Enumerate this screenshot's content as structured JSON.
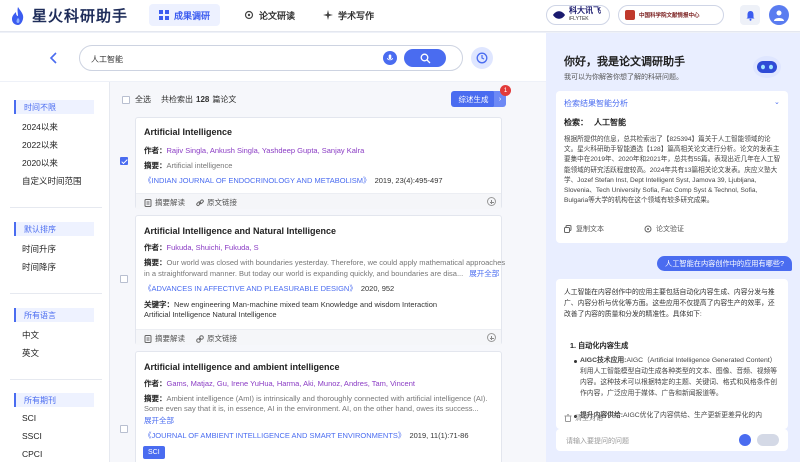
{
  "app": {
    "name": "星火科研助手"
  },
  "nav": [
    {
      "label": "成果调研",
      "active": true,
      "icon": "grid-icon"
    },
    {
      "label": "论文研读",
      "active": false,
      "icon": "gear-icon"
    },
    {
      "label": "学术写作",
      "active": false,
      "icon": "sparkle-icon"
    }
  ],
  "brands": {
    "iflytek": "科大讯飞",
    "iflytek_en": "iFLYTEK",
    "library": "中国科学院文献情报中心"
  },
  "search": {
    "query": "人工智能"
  },
  "filters": {
    "time": {
      "title": "时间不限",
      "items": [
        "2024以来",
        "2022以来",
        "2020以来",
        "自定义时间范围"
      ]
    },
    "sort": {
      "title": "默认排序",
      "items": [
        "时间升序",
        "时间降序"
      ]
    },
    "lang": {
      "title": "所有语言",
      "items": [
        "中文",
        "英文"
      ]
    },
    "journal": {
      "title": "所有期刊",
      "items": [
        "SCI",
        "SSCI",
        "CPCI"
      ]
    }
  },
  "results": {
    "select_all": "全选",
    "count_prefix": "共检索出",
    "count": "128",
    "count_suffix": "篇论文",
    "summary_button": "综述生成",
    "summary_badge": "1",
    "labels": {
      "author": "作者：",
      "abstract": "摘要：",
      "keywords": "关键字：",
      "expand": "展开全部",
      "digest": "摘要解读",
      "link": "原文链接"
    },
    "papers": [
      {
        "title": "Artificial Intelligence",
        "authors": "Rajiv Singla, Ankush Singla, Yashdeep Gupta, Sanjay Kalra",
        "abstract": "Artificial intelligence",
        "journal": "《INDIAN JOURNAL OF ENDOCRINOLOGY AND METABOLISM》",
        "info": "2019, 23(4):495-497",
        "checked": true
      },
      {
        "title": "Artificial Intelligence and Natural Intelligence",
        "authors": "Fukuda, Shuichi, Fukuda, S",
        "abstract1": "Our world was closed with boundaries yesterday. Therefore, we could apply mathematical approaches",
        "abstract2": "in a straightforward manner. But today our world is expanding quickly, and boundaries are disa...",
        "journal": "《ADVANCES IN AFFECTIVE AND PLEASURABLE DESIGN》",
        "info": "2020, 952",
        "keywords1": "New engineering   Man-machine mixed team   Knowledge and wisdom   Interaction",
        "keywords2": "Artificial Intelligence   Natural Intelligence",
        "checked": false
      },
      {
        "title": "Artificial intelligence and ambient intelligence",
        "authors": "Gams, Matjaz, Gu, Irene YuHua, Harma, Aki, Munoz, Andres, Tam, Vincent",
        "abstract1": "Ambient intelligence (AmI) is intrinsically and thoroughly connected with artificial intelligence (AI).",
        "abstract2": "Some even say that it is, in essence, AI in the environment. AI, on the other hand, owes its success...",
        "journal": "《JOURNAL OF AMBIENT INTELLIGENCE AND SMART ENVIRONMENTS》",
        "info": "2019, 11(1):71-86",
        "tag": "SCI",
        "checked": false
      }
    ]
  },
  "assistant": {
    "greeting": "你好，我是论文调研助手",
    "sub": "我可以为你解答你想了解的科研问题。",
    "analysis_title": "检索结果智能分析",
    "keyword_label": "检索：",
    "keyword": "人工智能",
    "analysis_body": "根据所提供的信息，总共检索出了【825394】篇关于人工智能领域的论文。星火科研助手智能遴选【128】篇高相关论文进行分析。论文的发表主要集中在2019年、2020年和2021年，总共有55篇。表现出近几年在人工智能领域的研究活跃程度较高。2024年共有13篇相关论文发表。庆应义塾大学、Jozef Stefan Inst, Dept Intelligent Syst, Jamova 39, Ljubljana, Slovenia、Tech University Sofia, Fac Comp Syst & Technol, Sofia, Bulgaria等大学的机构在这个领域有较多研究成果。",
    "copy": "复制文本",
    "verify": "论文验证",
    "user_question": "人工智能在内容创作中的应用有哪些?",
    "answer_intro": "人工智能在内容创作中的应用主要包括自动化内容生成、内容分发与推广、内容分析与优化等方面。这些应用不仅提高了内容生产的效率，还改善了内容的质量和分发的精准性。具体如下:",
    "answer_h1": "1. 自动化内容生成",
    "answer_b1_title": "AIGC技术应用:",
    "answer_b1": "AIGC（Artificial Intelligence Generated Content）利用人工智能模型自动生成各种类型的文本、图像、音频、视频等内容。这种技术可以根据特定的主题、关键词、格式和风格条件创作内容，广泛应用于媒体、广告和新闻报道等。",
    "answer_b2_title": "提升内容供给:",
    "answer_b2": "AIGC优化了内容供给、生产更新更差异化的内",
    "clear": "清空对话",
    "input_placeholder": "请输入要提问的问题"
  },
  "colors": {
    "accent": "#4a6cf0",
    "author": "#8a3bc4",
    "badge": "#e23a3a"
  }
}
